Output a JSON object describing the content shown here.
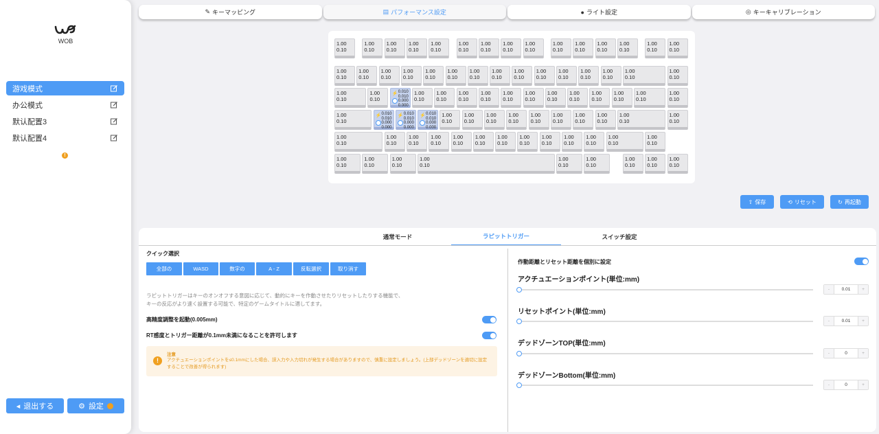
{
  "app": {
    "logo_text": "WOB"
  },
  "sidebar": {
    "profiles": [
      {
        "label": "游戏模式"
      },
      {
        "label": "办公模式"
      },
      {
        "label": "默认配置3"
      },
      {
        "label": "默认配置4"
      }
    ],
    "warn_badge": "!",
    "exit_label": "退出する",
    "settings_label": "設定"
  },
  "tabs": [
    {
      "label": "キーマッピング",
      "icon": "pen-icon"
    },
    {
      "label": "パフォーマンス設定",
      "icon": "chart-icon"
    },
    {
      "label": "ライト設定",
      "icon": "bulb-icon"
    },
    {
      "label": "キーキャリブレーション",
      "icon": "target-icon"
    }
  ],
  "keyboard": {
    "default_key": {
      "actuation": "1.00",
      "reset": "0.10"
    },
    "rapid_key": [
      "0.010",
      "0.010",
      "0.000",
      "0.000"
    ]
  },
  "actions": {
    "save": "保存",
    "reset": "リセット",
    "restart": "再起動"
  },
  "bottom": {
    "tabs": [
      "通常モード",
      "ラピットトリガー",
      "スイッチ設定"
    ],
    "quick_select": {
      "title": "クイック選択",
      "buttons": [
        "全部の",
        "WASD",
        "数字の",
        "A - Z",
        "反転選択",
        "取り消す"
      ]
    },
    "description_lines": [
      "ラピットトリガーはキーのオンオフする意図に応じて、動的にキーを作動させたりリセットしたりする機能で、",
      "キーの反応がより速く設置する可能で、特定のゲームタイトルに適してます。"
    ],
    "hp_label": "高精度調整を起動(0.005mm)",
    "rt_label": "RT感度とトリガー距離が0.1mm未満になることを許可します",
    "notice": {
      "title": "注意",
      "body": "アクチュエーションポイントを≤0.1mmにした場合、誤入力や入力切れが発生する場合がありますので、慎重に設定しましょう。(上部デッドゾーンを適切に設定することで改善が得られます)"
    },
    "right": {
      "separate_label": "作動距離とリセット距離を個別に設定",
      "rows": [
        {
          "label": "アクチュエーションポイント(単位:mm)",
          "value": "0.01"
        },
        {
          "label": "リセットポイント(単位:mm)",
          "value": "0.01"
        },
        {
          "label": "デッドゾーンTOP(単位:mm)",
          "value": "0"
        },
        {
          "label": "デッドゾーンBottom(単位:mm)",
          "value": "0"
        }
      ],
      "minus": "-",
      "plus": "+"
    }
  }
}
